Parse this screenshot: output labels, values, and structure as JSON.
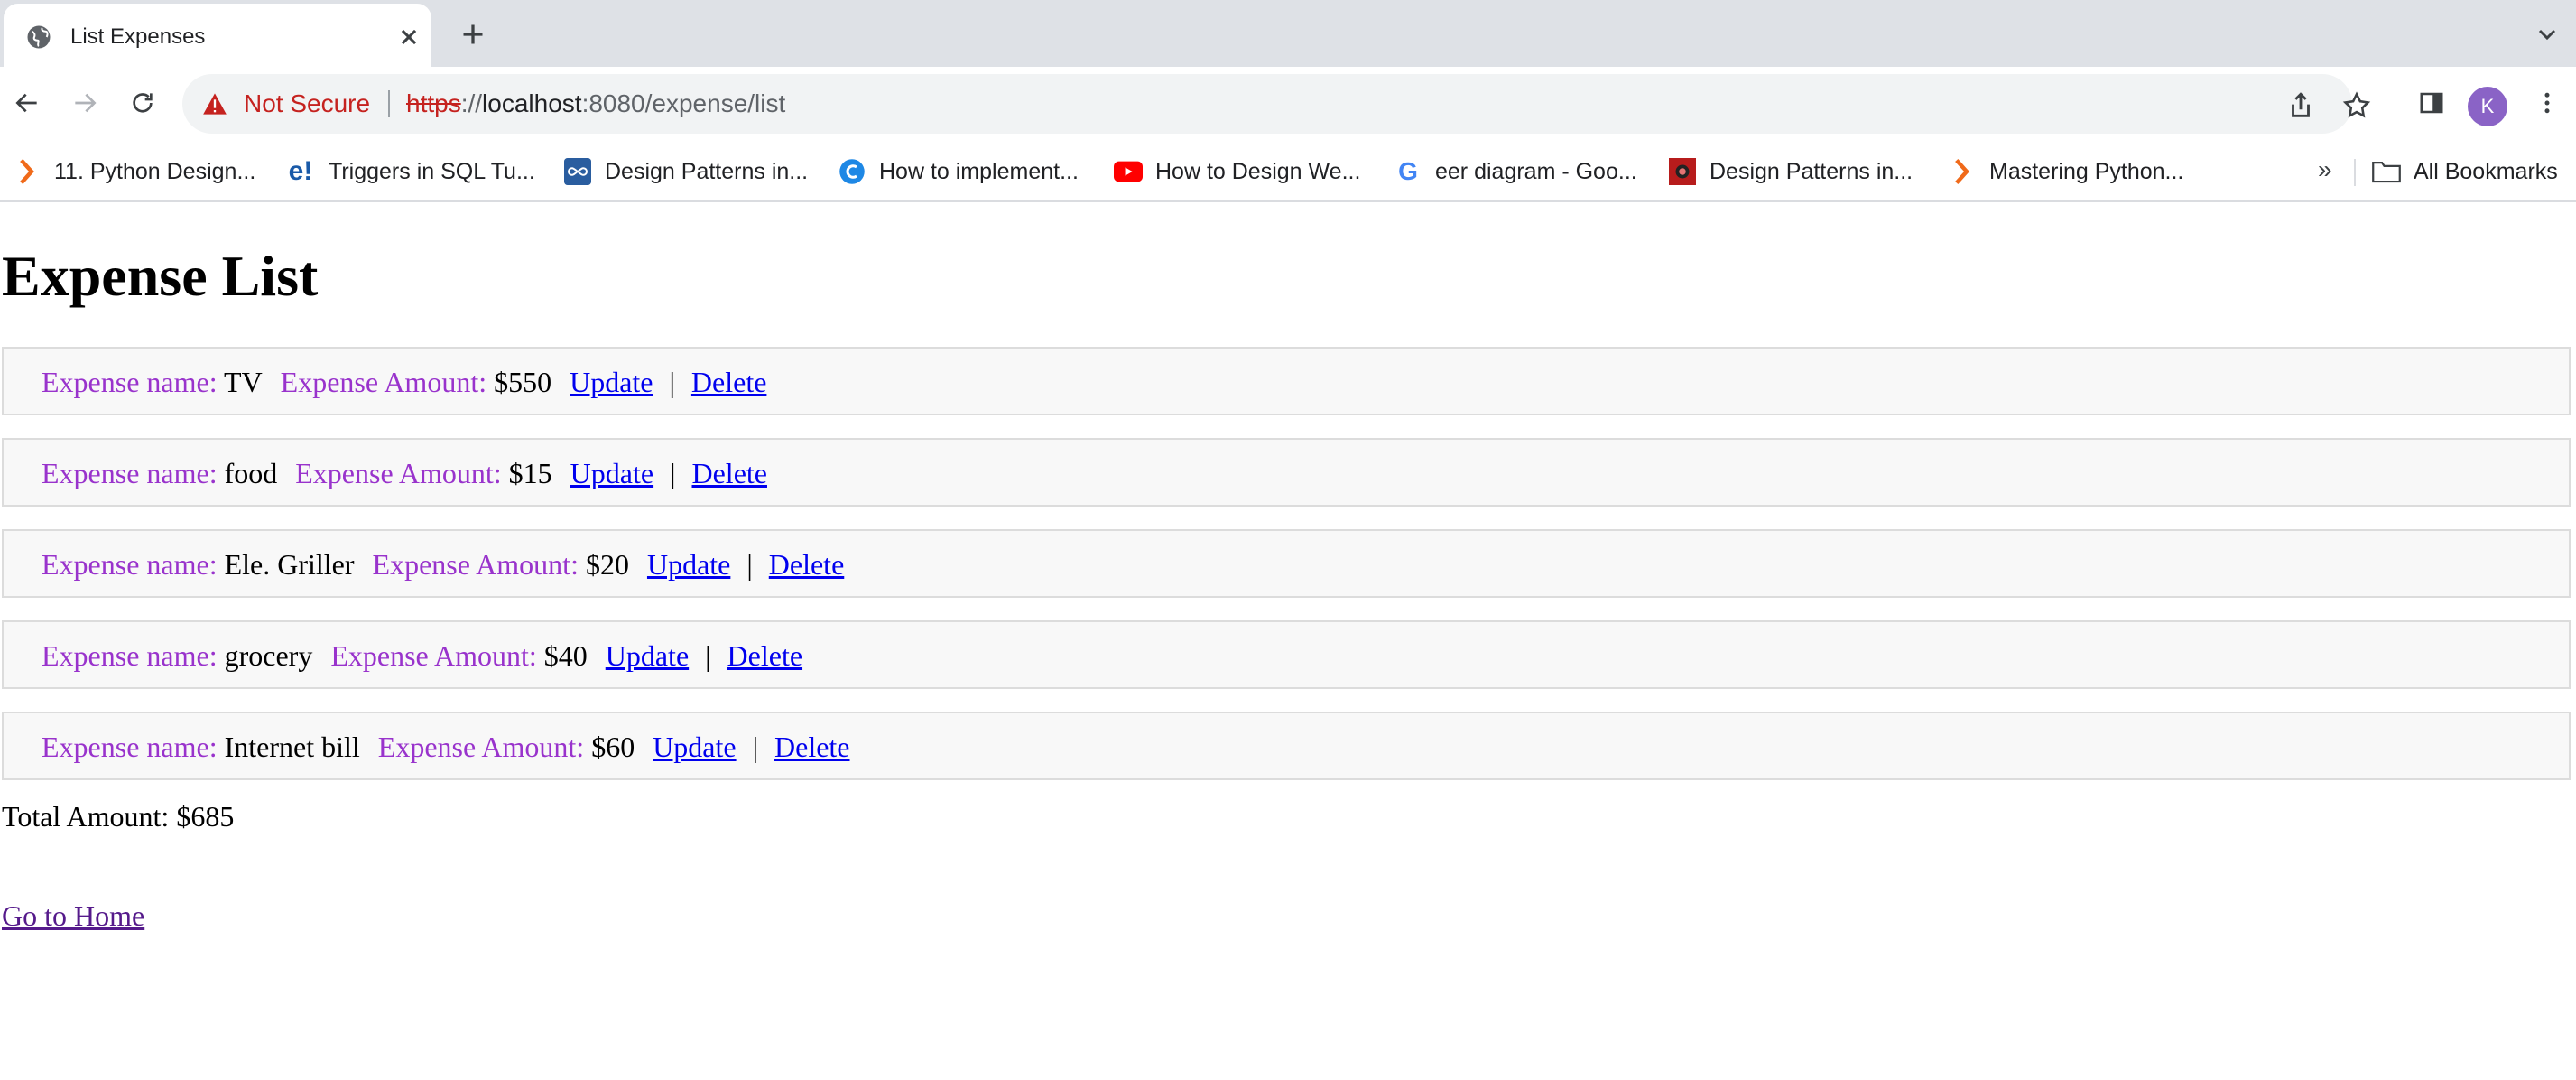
{
  "browser": {
    "tab_title": "List Expenses",
    "security_label": "Not Secure",
    "url_scheme": "https",
    "url_separator": "://",
    "url_host": "localhost",
    "url_path": ":8080/expense/list",
    "avatar_initial": "K",
    "bookmarks": [
      {
        "label": "11. Python Design...",
        "icon": "orange-chevron-icon"
      },
      {
        "label": "Triggers in SQL Tu...",
        "icon": "e-exclaim-icon"
      },
      {
        "label": "Design Patterns in...",
        "icon": "infinity-square-icon"
      },
      {
        "label": "How to implement...",
        "icon": "blue-c-icon"
      },
      {
        "label": "How to Design We...",
        "icon": "youtube-icon"
      },
      {
        "label": "eer diagram - Goo...",
        "icon": "google-icon"
      },
      {
        "label": "Design Patterns in...",
        "icon": "book-cover-icon"
      },
      {
        "label": "Mastering Python...",
        "icon": "orange-chevron-icon"
      }
    ],
    "bookmarks_overflow": "»",
    "all_bookmarks": "All Bookmarks"
  },
  "page": {
    "heading": "Expense List",
    "name_label": "Expense name:",
    "amount_label": "Expense Amount:",
    "update_label": "Update",
    "delete_label": "Delete",
    "separator": "|",
    "expenses": [
      {
        "name": "TV",
        "amount": "$550"
      },
      {
        "name": "food",
        "amount": "$15"
      },
      {
        "name": "Ele. Griller",
        "amount": "$20"
      },
      {
        "name": "grocery",
        "amount": "$40"
      },
      {
        "name": "Internet bill",
        "amount": "$60"
      }
    ],
    "total_label": "Total Amount:",
    "total_value": "$685",
    "home_link": "Go to Home"
  },
  "colors": {
    "label_purple": "#9933cc",
    "link_blue": "#0000ee",
    "visited_link": "#551a8b",
    "insecure_red": "#c5221f"
  }
}
